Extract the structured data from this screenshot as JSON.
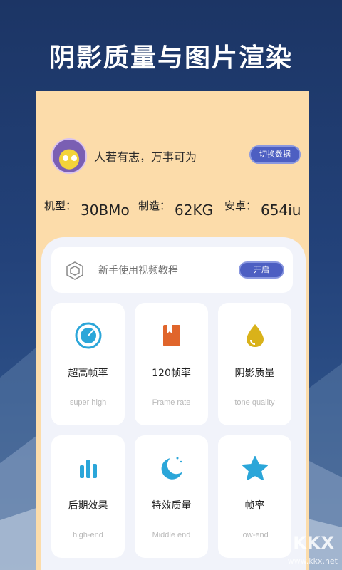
{
  "header": {
    "title": "阴影质量与图片渲染"
  },
  "profile": {
    "motto": "人若有志，万事可为",
    "switch_label": "切换数据"
  },
  "stats": [
    {
      "label": "机型：",
      "value": "30BMo"
    },
    {
      "label": "制造：",
      "value": "62KG"
    },
    {
      "label": "安卓：",
      "value": "654iu"
    }
  ],
  "tutorial": {
    "text": "新手使用视频教程",
    "button": "开启"
  },
  "tiles": [
    {
      "name": "超高帧率",
      "sub": "super high",
      "icon": "timer-icon"
    },
    {
      "name": "120帧率",
      "sub": "Frame rate",
      "icon": "book-icon"
    },
    {
      "name": "阴影质量",
      "sub": "tone quality",
      "icon": "drop-icon"
    },
    {
      "name": "后期效果",
      "sub": "high-end",
      "icon": "bars-icon"
    },
    {
      "name": "特效质量",
      "sub": "Middle end",
      "icon": "moon-icon"
    },
    {
      "name": "帧率",
      "sub": "low-end",
      "icon": "star-icon"
    }
  ],
  "watermark": {
    "main": "KKX",
    "sub": "www.kkx.net"
  },
  "colors": {
    "accent": "#4d5fc2",
    "card": "#fcdcaa",
    "panel": "#f1f3fa"
  }
}
